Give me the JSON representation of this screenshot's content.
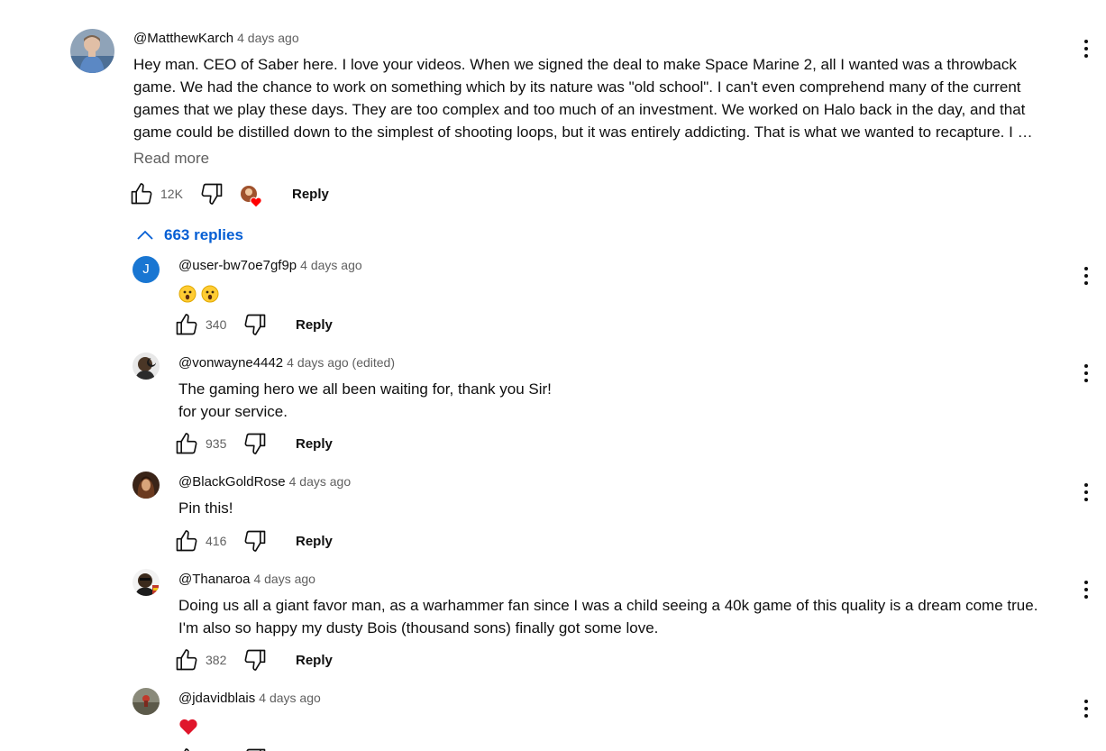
{
  "main_comment": {
    "author": "@MatthewKarch",
    "time": "4 days ago",
    "text_lines": [
      "Hey man.  CEO of Saber here.  I love your videos.  When we signed the deal to make Space Marine 2, all I wanted was a throwback",
      "game.  We had the chance to work on something which by its nature was \"old school\".  I can't even comprehend many of the current",
      "games that we play these days.  They are too complex and too much of an investment.  We worked on Halo back in the day, and that",
      "game could be distilled down to the simplest of shooting loops, but it was entirely addicting. That is what we wanted to recapture.  I …"
    ],
    "read_more": "Read more",
    "likes": "12K",
    "reply_label": "Reply"
  },
  "replies_toggle": {
    "label": "663 replies",
    "icon": "chevron-up-icon",
    "color": "#065fd4"
  },
  "replies": [
    {
      "author": "@user-bw7oe7gf9p",
      "time": "4 days ago",
      "avatar_letter": "J",
      "avatar_color": "#1976d2",
      "emoji": [
        "astonished-face",
        "astonished-face"
      ],
      "likes": "340",
      "reply_label": "Reply"
    },
    {
      "author": "@vonwayne4442",
      "time": "4 days ago (edited)",
      "text_lines": [
        "The gaming hero we all been waiting for, thank you Sir!",
        "for your service."
      ],
      "likes": "935",
      "reply_label": "Reply"
    },
    {
      "author": "@BlackGoldRose",
      "time": "4 days ago",
      "text_lines": [
        "Pin this!"
      ],
      "likes": "416",
      "reply_label": "Reply"
    },
    {
      "author": "@Thanaroa",
      "time": "4 days ago",
      "text_lines": [
        "Doing us all a giant favor man, as a warhammer fan since I was a child seeing a 40k game of this quality is a dream come true.",
        "I'm also so happy my dusty Bois (thousand sons) finally got some love."
      ],
      "likes": "382",
      "reply_label": "Reply"
    },
    {
      "author": "@jdavidblais",
      "time": "4 days ago",
      "emoji": [
        "red-heart"
      ]
    }
  ],
  "colors": {
    "text": "#0f0f0f",
    "secondary": "#606060",
    "link": "#065fd4",
    "heart": "#ff0000"
  }
}
